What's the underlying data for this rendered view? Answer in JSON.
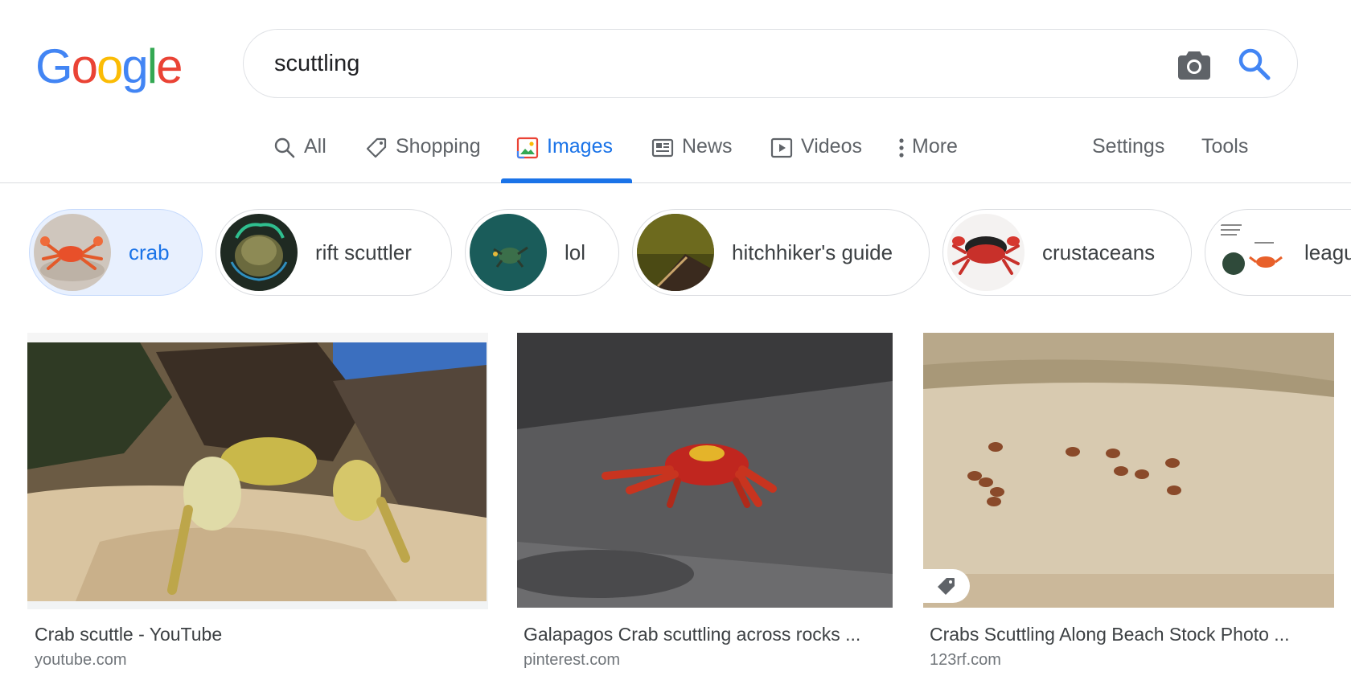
{
  "logo": {
    "letters": [
      "G",
      "o",
      "o",
      "g",
      "l",
      "e"
    ],
    "colors": [
      "#4285F4",
      "#EA4335",
      "#FBBC05",
      "#4285F4",
      "#34A853",
      "#EA4335"
    ]
  },
  "search": {
    "query": "scuttling",
    "camera_icon": "camera-icon",
    "search_icon": "search-icon"
  },
  "tabs": [
    {
      "label": "All",
      "icon": "search-icon"
    },
    {
      "label": "Shopping",
      "icon": "tag-icon"
    },
    {
      "label": "Images",
      "icon": "image-icon",
      "active": true
    },
    {
      "label": "News",
      "icon": "news-icon"
    },
    {
      "label": "Videos",
      "icon": "play-icon"
    },
    {
      "label": "More",
      "icon": "more-vert-icon"
    }
  ],
  "tools": {
    "settings": "Settings",
    "tools": "Tools"
  },
  "chips": [
    {
      "label": "crab",
      "selected": true
    },
    {
      "label": "rift scuttler"
    },
    {
      "label": "lol"
    },
    {
      "label": "hitchhiker's guide"
    },
    {
      "label": "crustaceans"
    },
    {
      "label": "league"
    }
  ],
  "results": [
    {
      "title": "Crab scuttle - YouTube",
      "source": "youtube.com"
    },
    {
      "title": "Galapagos Crab scuttling across rocks ...",
      "source": "pinterest.com"
    },
    {
      "title": "Crabs Scuttling Along Beach Stock Photo ...",
      "source": "123rf.com",
      "badge_icon": "price-tag-icon"
    }
  ],
  "colors": {
    "accent": "#1a73e8",
    "text_secondary": "#5f6368",
    "chip_selected_bg": "#e8f0fe"
  }
}
